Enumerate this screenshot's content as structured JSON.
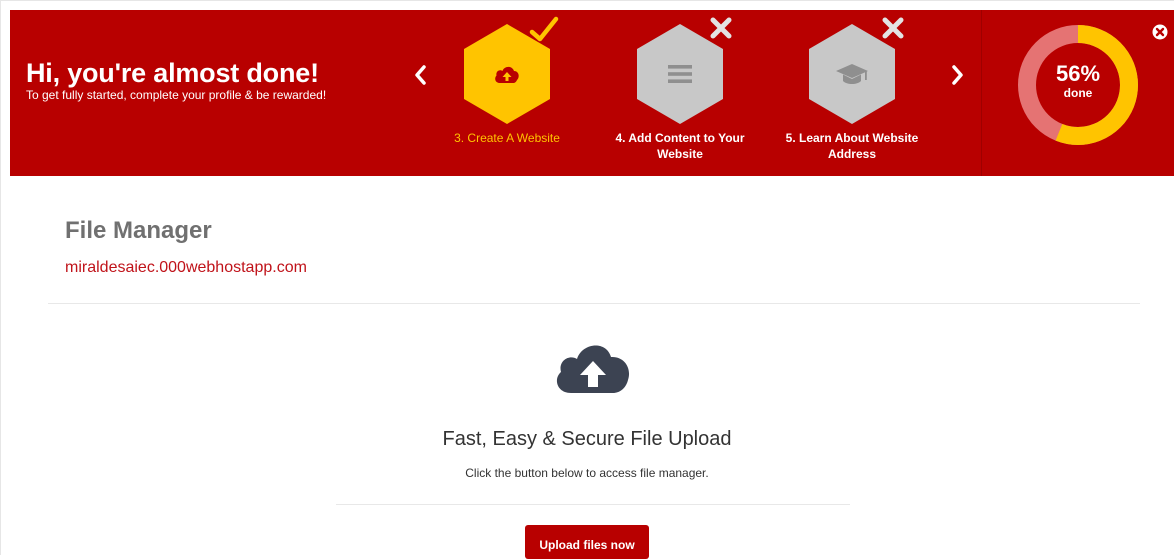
{
  "banner": {
    "heading": "Hi, you're almost done!",
    "subheading": "To get fully started, complete your profile & be rewarded!",
    "steps": [
      {
        "label": "3. Create A Website",
        "icon": "cloud-upload-icon",
        "status": "completed",
        "color": "#ffc400"
      },
      {
        "label": "4. Add Content to Your Website",
        "icon": "lines-icon",
        "status": "incomplete",
        "color": "#c8c8c8"
      },
      {
        "label": "5. Learn About Website Address",
        "icon": "graduation-cap-icon",
        "status": "incomplete",
        "color": "#c8c8c8"
      }
    ],
    "progress": {
      "percent_label": "56%",
      "percent_value": 56,
      "done_label": "done"
    },
    "colors": {
      "background": "#b80000",
      "accent": "#ffc400"
    }
  },
  "page": {
    "title": "File Manager",
    "domain": "miraldesaiec.000webhostapp.com",
    "upload_icon": "cloud-upload-icon",
    "headline": "Fast, Easy & Secure File Upload",
    "description": "Click the button below to access file manager.",
    "upload_button": "Upload files now"
  }
}
